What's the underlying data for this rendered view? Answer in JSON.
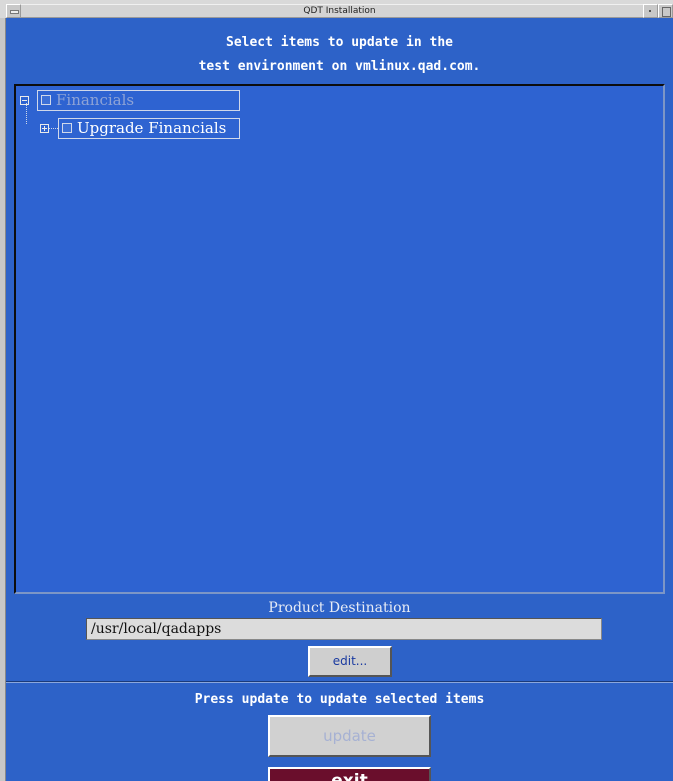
{
  "window": {
    "title": "QDT Installation"
  },
  "header": {
    "line1": "Select items to update in the",
    "line2": "test environment on vmlinux.qad.com."
  },
  "tree": {
    "root": {
      "label": "Financials",
      "expanded": true,
      "checked": false,
      "enabled": false
    },
    "child": {
      "label": "Upgrade Financials",
      "expanded": false,
      "checked": false
    }
  },
  "destination": {
    "label": "Product Destination",
    "path": "/usr/local/qadapps",
    "edit_label": "edit..."
  },
  "footer": {
    "message": "Press update to update selected items",
    "update_label": "update",
    "exit_label": "exit"
  },
  "colors": {
    "panel_blue": "#2d62c8",
    "exit_maroon": "#6a0e2c",
    "disabled_text": "#a6b1d3"
  }
}
